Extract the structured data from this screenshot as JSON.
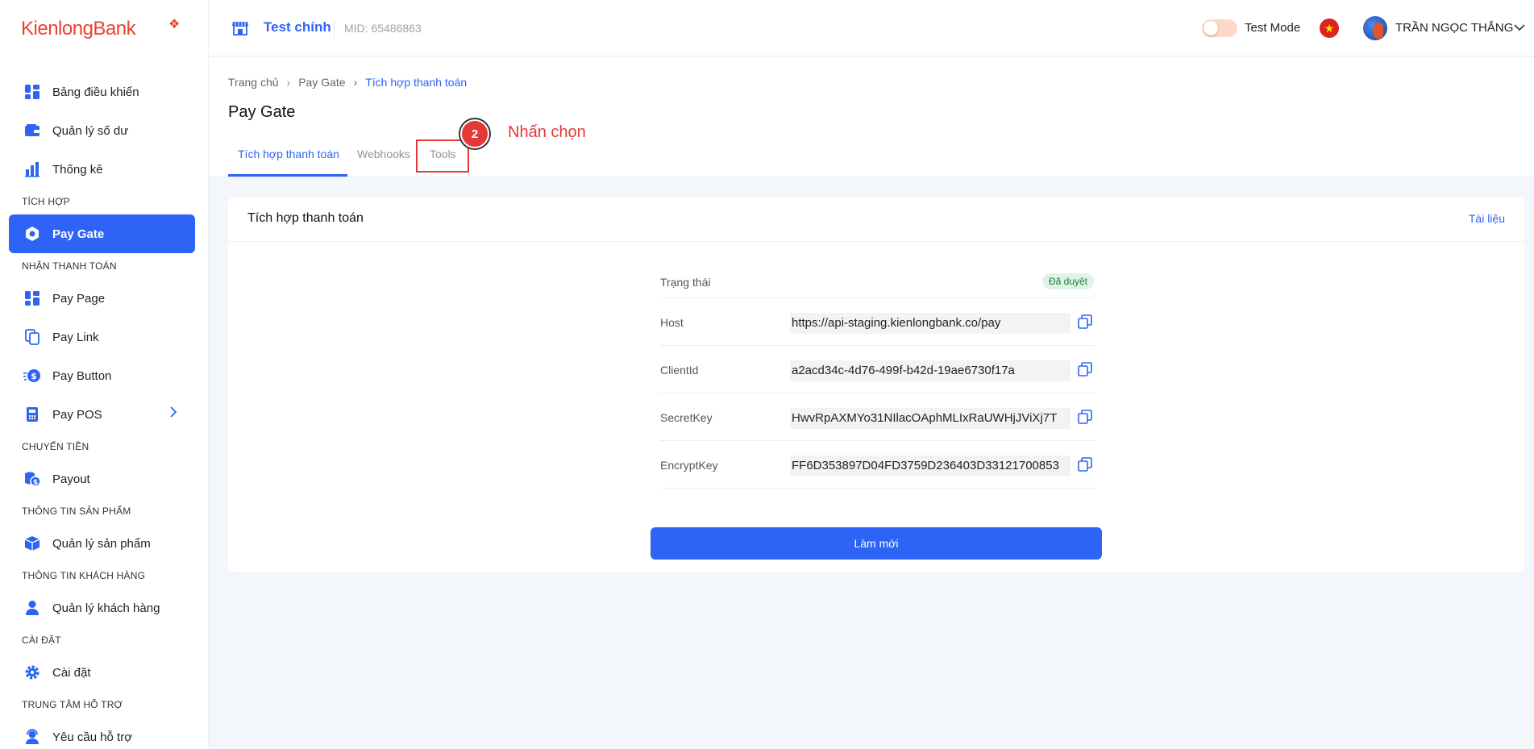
{
  "brand": {
    "logo_text": "KienlongBank"
  },
  "header": {
    "store_name": "Test chính",
    "mid": "MID: 65486863",
    "test_mode_label": "Test Mode",
    "user_name": "TRẦN NGỌC THẮNG"
  },
  "sidebar": {
    "items": [
      {
        "label": "Bảng điều khiển"
      },
      {
        "label": "Quản lý số dư"
      },
      {
        "label": "Thống kê"
      },
      {
        "label": "Pay Gate"
      },
      {
        "label": "Pay Page"
      },
      {
        "label": "Pay Link"
      },
      {
        "label": "Pay Button"
      },
      {
        "label": "Pay POS"
      },
      {
        "label": "Payout"
      },
      {
        "label": "Quản lý sản phẩm"
      },
      {
        "label": "Quản lý khách hàng"
      },
      {
        "label": "Cài đặt"
      },
      {
        "label": "Yêu cầu hỗ trợ"
      }
    ],
    "sections": [
      "TÍCH HỢP",
      "NHẬN THANH TOÁN",
      "CHUYỂN TIỀN",
      "THÔNG TIN SẢN PHẨM",
      "THÔNG TIN KHÁCH HÀNG",
      "CÀI ĐẶT",
      "TRUNG TÂM HỖ TRỢ"
    ]
  },
  "breadcrumb": [
    "Trang chủ",
    "Pay Gate",
    "Tích hợp thanh toán"
  ],
  "page": {
    "title": "Pay Gate",
    "tabs": [
      "Tích hợp thanh toán",
      "Webhooks",
      "Tools"
    ],
    "annotation": {
      "step": "2",
      "text": "Nhấn chọn"
    }
  },
  "card": {
    "title": "Tích hợp thanh toán",
    "doc_link": "Tài liệu",
    "status_label": "Trạng thái",
    "status_value": "Đã duyệt",
    "fields": [
      {
        "label": "Host",
        "value": "https://api-staging.kienlongbank.co/pay"
      },
      {
        "label": "ClientId",
        "value": "a2acd34c-4d76-499f-b42d-19ae6730f17a"
      },
      {
        "label": "SecretKey",
        "value": "HwvRpAXMYo31NIlacOAphMLIxRaUWHjJViXj7T"
      },
      {
        "label": "EncryptKey",
        "value": "FF6D353897D04FD3759D236403D33121700853"
      }
    ],
    "refresh_button": "Làm mới"
  },
  "colors": {
    "accent": "#2e64f6",
    "annotation": "#e53935",
    "status_bg": "#def4e4"
  }
}
